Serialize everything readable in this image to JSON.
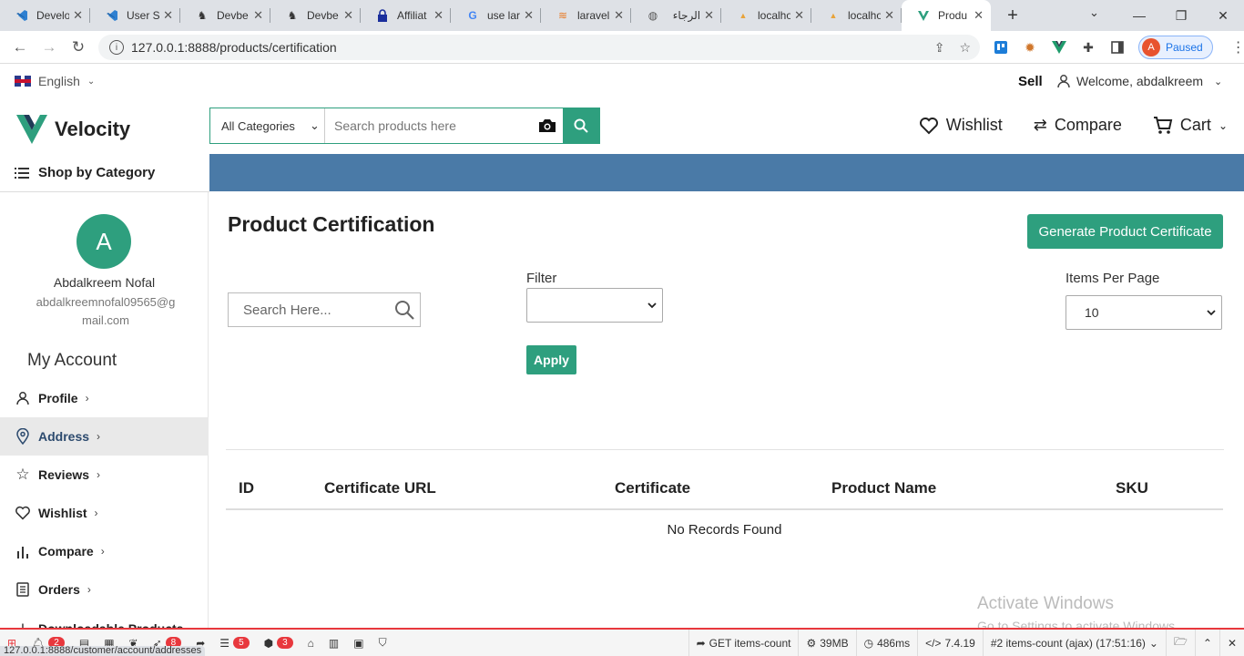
{
  "browser": {
    "tabs": [
      {
        "title": "Develo",
        "icon": "vscode-icon"
      },
      {
        "title": "User S",
        "icon": "vscode-icon"
      },
      {
        "title": "Devbe",
        "icon": "horse-icon"
      },
      {
        "title": "Devbe",
        "icon": "horse-icon"
      },
      {
        "title": "Affiliat",
        "icon": "lock-icon"
      },
      {
        "title": "use lar",
        "icon": "google-icon"
      },
      {
        "title": "laravel",
        "icon": "stack-icon"
      },
      {
        "title": "الرجاء",
        "icon": "globe-icon"
      },
      {
        "title": "localho",
        "icon": "pma-icon"
      },
      {
        "title": "localho",
        "icon": "pma-icon"
      },
      {
        "title": "Produ",
        "icon": "velocity-icon"
      }
    ],
    "url": "127.0.0.1:8888/products/certification",
    "profile_initial": "A",
    "profile_status": "Paused"
  },
  "topbar": {
    "language": "English",
    "sell": "Sell",
    "welcome": "Welcome, abdalkreem"
  },
  "header": {
    "logo_text": "Velocity",
    "category_select": "All Categories",
    "search_placeholder": "Search products here",
    "wishlist": "Wishlist",
    "compare": "Compare",
    "cart": "Cart"
  },
  "catbar": {
    "shop_by_category": "Shop by Category"
  },
  "sidebar": {
    "avatar_initial": "A",
    "user_name": "Abdalkreem Nofal",
    "user_email": "abdalkreemnofal09565@gmail.com",
    "section_title": "My Account",
    "items": [
      {
        "label": "Profile",
        "icon": "user-icon",
        "active": false
      },
      {
        "label": "Address",
        "icon": "location-pin-icon",
        "active": true
      },
      {
        "label": "Reviews",
        "icon": "star-icon",
        "active": false
      },
      {
        "label": "Wishlist",
        "icon": "heart-icon",
        "active": false
      },
      {
        "label": "Compare",
        "icon": "bars-icon",
        "active": false
      },
      {
        "label": "Orders",
        "icon": "receipt-icon",
        "active": false
      },
      {
        "label": "Downloadable Products",
        "icon": "download-icon",
        "active": false
      }
    ]
  },
  "main": {
    "title": "Product Certification",
    "generate_button": "Generate Product Certificate",
    "search_placeholder": "Search Here...",
    "filter_label": "Filter",
    "filter_value": "",
    "apply_button": "Apply",
    "items_per_page_label": "Items Per Page",
    "items_per_page_value": "10",
    "table": {
      "columns": [
        "ID",
        "Certificate URL",
        "Certificate",
        "Product Name",
        "SKU"
      ],
      "empty_text": "No Records Found"
    },
    "watermark_line1": "Activate Windows",
    "watermark_line2": "Go to Settings to activate Windows."
  },
  "debugbar": {
    "status_url": "127.0.0.1:8888/customer/account/addresses",
    "badges": [
      "2",
      "8",
      "5",
      "3"
    ],
    "request": "GET items-count",
    "memory": "39MB",
    "time": "486ms",
    "php_version": "7.4.19",
    "ajax_request": "#2 items-count (ajax) (17:51:16)"
  },
  "colors": {
    "brand_green": "#2e9f7e",
    "category_bar_blue": "#4a7aa7",
    "debug_red": "#e8383d"
  }
}
